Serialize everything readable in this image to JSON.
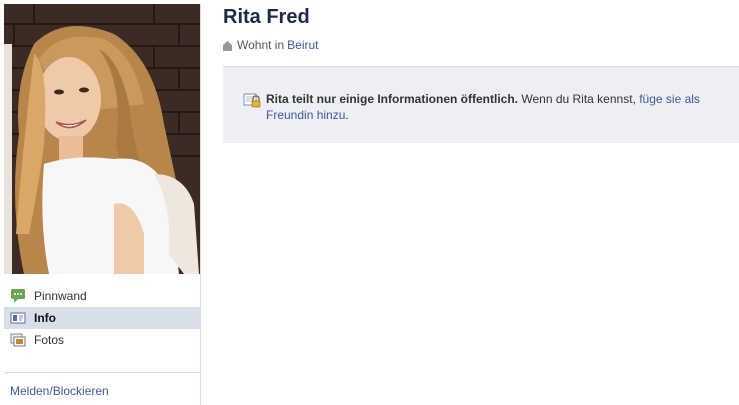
{
  "profile": {
    "name": "Rita Fred",
    "lives_prefix": "Wohnt in",
    "lives_city": "Beirut"
  },
  "nav": {
    "items": [
      {
        "label": "Pinnwand",
        "icon": "wall-icon"
      },
      {
        "label": "Info",
        "icon": "info-icon",
        "active": true
      },
      {
        "label": "Fotos",
        "icon": "photos-icon"
      }
    ],
    "report_label": "Melden/Blockieren"
  },
  "privacy": {
    "bold_text": "Rita teilt nur einige Informationen öffentlich.",
    "plain_text": "Wenn du Rita kennst,",
    "link_text": "füge sie als Freundin hinzu",
    "end_text": "."
  },
  "colors": {
    "link": "#3b5998",
    "nav_active_bg": "#d8dfea",
    "notice_bg": "#edeff4",
    "name": "#1c2a47"
  }
}
